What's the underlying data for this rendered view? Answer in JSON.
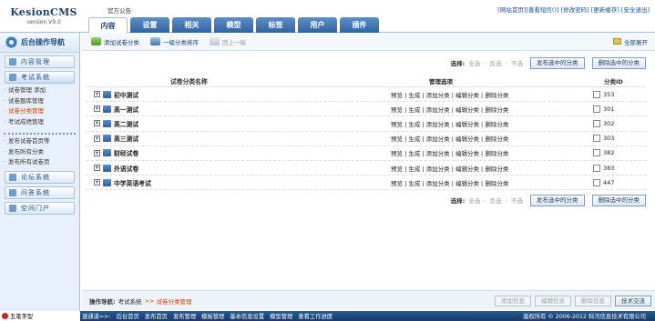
{
  "app": {
    "name": "KesionCMS",
    "version": "version V9.0"
  },
  "header": {
    "announcement": "官方公告:",
    "top_links": [
      "[网站首页]",
      "[查看短信(",
      ")]",
      "[修改密码]",
      "[更新缓存]",
      "[安全退出]"
    ],
    "tabs": [
      "内容",
      "设置",
      "相关",
      "模型",
      "标签",
      "用户",
      "插件"
    ]
  },
  "sidebar": {
    "title": "后台操作导航",
    "sections": [
      "内容管理",
      "考试系统"
    ],
    "exam_items": [
      "试卷管理 添加",
      "试卷题库管理",
      "试卷分类管理",
      "考试成绩管理"
    ],
    "publish_items": [
      "发布试卷首页等",
      "发布所有分类",
      "发布所有试卷页"
    ],
    "more_sections": [
      "论坛系统",
      "问答系统",
      "空间门户"
    ]
  },
  "toolbar": {
    "add_category": "添加试卷分类",
    "sort": "一级分类排序",
    "back": "回上一级",
    "expand_all": "全部展开"
  },
  "select_bar": {
    "label": "选择:",
    "all": "全选",
    "invert": "反选",
    "none": "不选",
    "sep": "-",
    "publish_btn": "发布选中的分类",
    "delete_btn": "删除选中的分类"
  },
  "table": {
    "headers": [
      "试卷分类名称",
      "管理选项",
      "分类ID"
    ],
    "ops": [
      "预览",
      "生成",
      "添加分类",
      "编辑分类",
      "删除分类"
    ],
    "rows": [
      {
        "name": "初中测试",
        "id": "353"
      },
      {
        "name": "高一测试",
        "id": "301"
      },
      {
        "name": "高二测试",
        "id": "302"
      },
      {
        "name": "高三测试",
        "id": "303"
      },
      {
        "name": "财经试卷",
        "id": "382"
      },
      {
        "name": "外语试卷",
        "id": "383"
      },
      {
        "name": "中学英语考试",
        "id": "447"
      }
    ]
  },
  "bottom": {
    "nav_label": "操作导航:",
    "nav_path": "考试系统",
    "nav_arrow": ">>",
    "nav_current": "试卷分类管理",
    "buttons": [
      "添加信息",
      "编辑信息",
      "删除信息",
      "技术交流"
    ]
  },
  "statusbar": {
    "ime": "五笔字型",
    "links": [
      "速通道=>:",
      "后台首页",
      "发布首页",
      "发布管理",
      "模板管理",
      "基本信息设置",
      "模型管理",
      "查看工作进度"
    ],
    "copyright": "版权所有 © 2006-2012 科汛信息技术有限公司"
  }
}
